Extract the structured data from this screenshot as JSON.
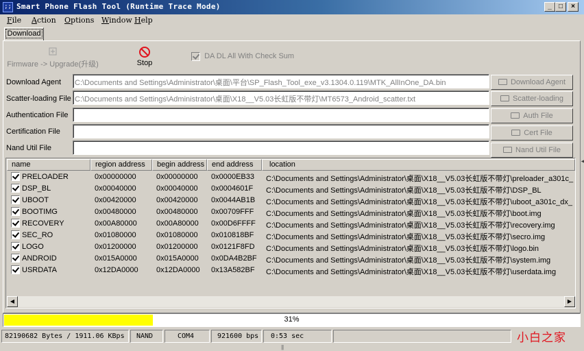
{
  "window": {
    "title": "Smart Phone Flash Tool (Runtime Trace Mode)",
    "icon_text": ";;",
    "min_glyph": "_",
    "max_glyph": "□",
    "close_glyph": "×"
  },
  "menu": [
    {
      "label": "File",
      "accel": "F",
      "rest": "ile"
    },
    {
      "label": "Action",
      "accel": "A",
      "rest": "ction"
    },
    {
      "label": "Options",
      "accel": "O",
      "rest": "ptions"
    },
    {
      "label": "Window",
      "accel": "W",
      "rest": "indow"
    },
    {
      "label": "Help",
      "accel": "H",
      "rest": "elp"
    }
  ],
  "tabs": {
    "download": "Download"
  },
  "toolbar": {
    "firmware_upgrade": "Firmware -> Upgrade(升级)",
    "stop": "Stop",
    "da_dl_check": "DA DL All With Check Sum"
  },
  "fields": {
    "download_agent": {
      "label": "Download Agent",
      "value": "C:\\Documents and Settings\\Administrator\\桌面\\平台\\SP_Flash_Tool_exe_v3.1304.0.119\\MTK_AllInOne_DA.bin",
      "button": "Download Agent"
    },
    "scatter": {
      "label": "Scatter-loading File",
      "value": "C:\\Documents and Settings\\Administrator\\桌面\\X18__V5.03长虹版不带灯\\MT6573_Android_scatter.txt",
      "button": "Scatter-loading"
    },
    "auth": {
      "label": "Authentication File",
      "value": "",
      "button": "Auth File"
    },
    "cert": {
      "label": "Certification File",
      "value": "",
      "button": "Cert File"
    },
    "nand": {
      "label": "Nand Util File",
      "value": "",
      "button": "Nand Util File"
    }
  },
  "table": {
    "headers": [
      "name",
      "region address",
      "begin address",
      "end address",
      "location"
    ],
    "rows": [
      {
        "name": "PRELOADER",
        "region": "0x00000000",
        "begin": "0x00000000",
        "end": "0x0000EB33",
        "location": "C:\\Documents and Settings\\Administrator\\桌面\\X18__V5.03长虹版不带灯\\preloader_a301c_"
      },
      {
        "name": "DSP_BL",
        "region": "0x00040000",
        "begin": "0x00040000",
        "end": "0x0004601F",
        "location": "C:\\Documents and Settings\\Administrator\\桌面\\X18__V5.03长虹版不带灯\\DSP_BL"
      },
      {
        "name": "UBOOT",
        "region": "0x00420000",
        "begin": "0x00420000",
        "end": "0x0044AB1B",
        "location": "C:\\Documents and Settings\\Administrator\\桌面\\X18__V5.03长虹版不带灯\\uboot_a301c_dx_"
      },
      {
        "name": "BOOTIMG",
        "region": "0x00480000",
        "begin": "0x00480000",
        "end": "0x00709FFF",
        "location": "C:\\Documents and Settings\\Administrator\\桌面\\X18__V5.03长虹版不带灯\\boot.img"
      },
      {
        "name": "RECOVERY",
        "region": "0x00A80000",
        "begin": "0x00A80000",
        "end": "0x00D6FFFF",
        "location": "C:\\Documents and Settings\\Administrator\\桌面\\X18__V5.03长虹版不带灯\\recovery.img"
      },
      {
        "name": "SEC_RO",
        "region": "0x01080000",
        "begin": "0x01080000",
        "end": "0x010818BF",
        "location": "C:\\Documents and Settings\\Administrator\\桌面\\X18__V5.03长虹版不带灯\\secro.img"
      },
      {
        "name": "LOGO",
        "region": "0x01200000",
        "begin": "0x01200000",
        "end": "0x0121F8FD",
        "location": "C:\\Documents and Settings\\Administrator\\桌面\\X18__V5.03长虹版不带灯\\logo.bin"
      },
      {
        "name": "ANDROID",
        "region": "0x015A0000",
        "begin": "0x015A0000",
        "end": "0x0DA4B2BF",
        "location": "C:\\Documents and Settings\\Administrator\\桌面\\X18__V5.03长虹版不带灯\\system.img"
      },
      {
        "name": "USRDATA",
        "region": "0x12DA0000",
        "begin": "0x12DA0000",
        "end": "0x13A582BF",
        "location": "C:\\Documents and Settings\\Administrator\\桌面\\X18__V5.03长虹版不带灯\\userdata.img"
      }
    ]
  },
  "progress": {
    "fraction": 0.31,
    "label": "31%",
    "color": "#ffff00"
  },
  "status": {
    "bytes": "82190682 Bytes / 1911.06 KBps",
    "storage": "NAND",
    "port": "COM4",
    "baud": "921600 bps",
    "time": "0:53 sec"
  },
  "watermark": "小白之家",
  "colors": {
    "stop_icon": "#e0141e",
    "title_start": "#0a246a",
    "title_end": "#a6caf0"
  }
}
